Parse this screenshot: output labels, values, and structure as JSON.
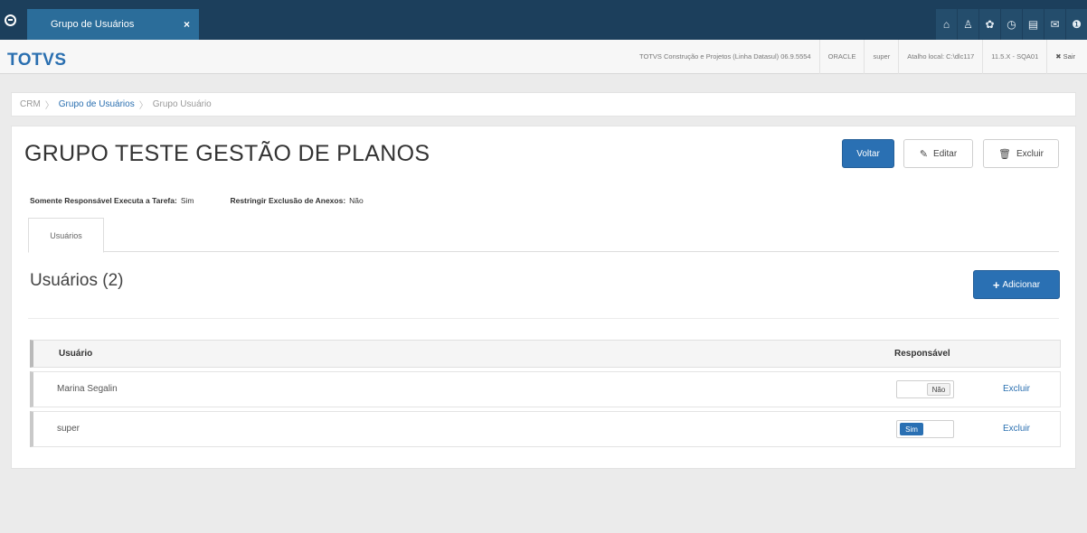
{
  "app": {
    "tab_title": "Grupo de Usuários",
    "tab_close": "×",
    "brand": "TOTVS",
    "top_icons": [
      "home-icon",
      "sitemap-icon",
      "gear-icon",
      "clock-icon",
      "document-icon",
      "mail-icon",
      "help-icon"
    ],
    "top_icon_glyphs": [
      "⌂",
      "♙",
      "✿",
      "◷",
      "▤",
      "✉",
      "❶"
    ]
  },
  "infobar": {
    "company": "TOTVS Construção e Projetos (Linha Datasul) 06.9.5554",
    "database": "ORACLE",
    "user": "super",
    "shortcut": "Atalho local: C:\\dlc117",
    "version": "11.5.X - SQA01",
    "exit_label": "✖ Sair"
  },
  "breadcrumb": {
    "items": [
      "CRM",
      "Grupo de Usuários",
      "Grupo Usuário"
    ],
    "separator": "〉"
  },
  "page": {
    "title": "GRUPO TESTE GESTÃO DE PLANOS",
    "back_label": "Voltar",
    "edit_label": "Editar",
    "edit_icon": "✎",
    "delete_label": "Excluir",
    "delete_icon": "🗑"
  },
  "properties": [
    {
      "label": "Somente Responsável Executa a Tarefa:",
      "value": "Sim"
    },
    {
      "label": "Restringir Exclusão de Anexos:",
      "value": "Não"
    }
  ],
  "tabs": [
    {
      "label": "Usuários"
    }
  ],
  "users_section": {
    "title": "Usuários (2)",
    "add_label": "Adicionar",
    "add_icon": "+"
  },
  "table": {
    "columns": [
      "Usuário",
      "Responsável"
    ],
    "rows": [
      {
        "user": "Marina Segalin",
        "responsible": "Não",
        "responsible_on": false,
        "action": "Excluir"
      },
      {
        "user": "super",
        "responsible": "Sim",
        "responsible_on": true,
        "action": "Excluir"
      }
    ]
  },
  "colors": {
    "topbar": "#1c3f5c",
    "active_tab": "#2b6d9a",
    "primary": "#2a70b3",
    "brand": "#2a6fb0"
  }
}
